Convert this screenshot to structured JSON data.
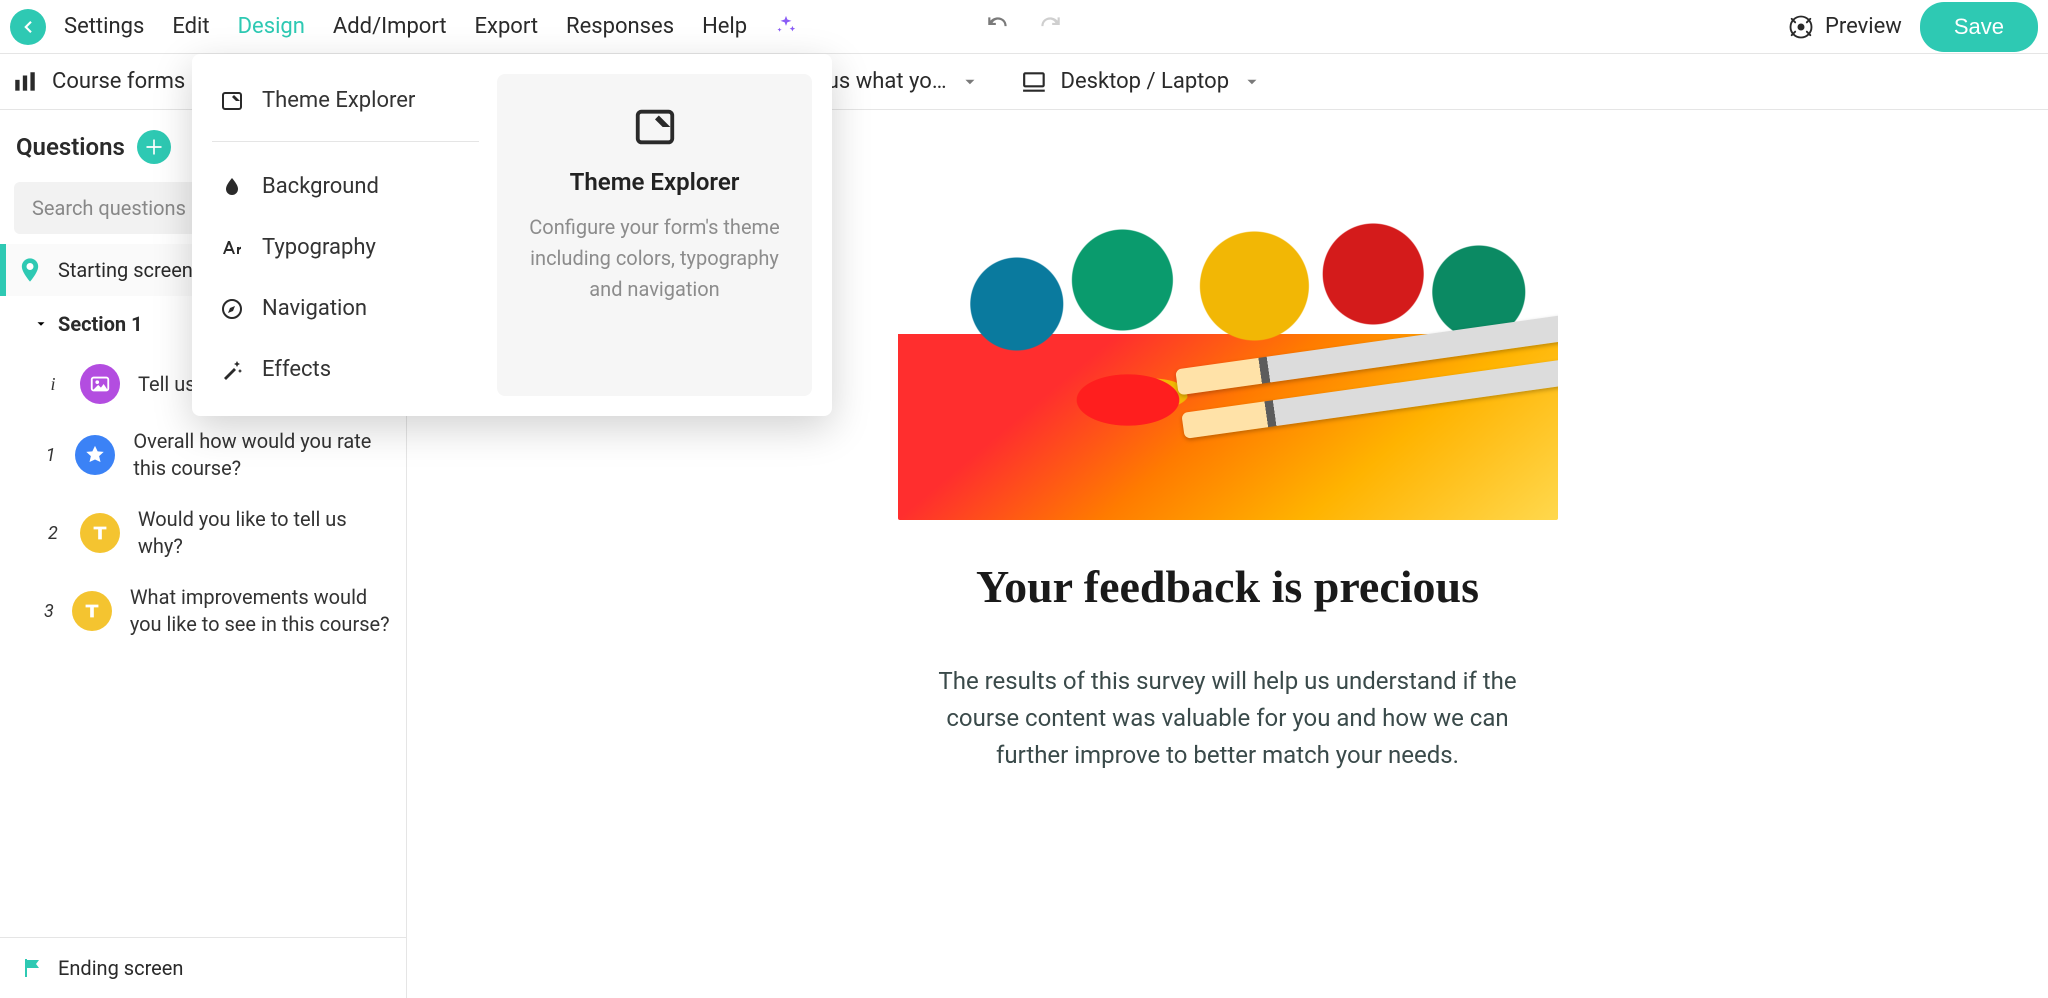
{
  "topbar": {
    "menu": [
      "Settings",
      "Edit",
      "Design",
      "Add/Import",
      "Export",
      "Responses",
      "Help"
    ],
    "active_index": 2,
    "preview_label": "Preview",
    "save_label": "Save"
  },
  "subbar": {
    "breadcrumb": "Course forms",
    "page_selector": "Tell us what yo…",
    "device_selector": "Desktop / Laptop"
  },
  "sidebar": {
    "header": "Questions",
    "search_placeholder": "Search questions",
    "starting_screen": "Starting screen",
    "section_title": "Section 1",
    "questions": [
      {
        "num": "i",
        "text": "Tell us",
        "badge": "purple",
        "icon": "image"
      },
      {
        "num": "1",
        "text": "Overall how would you rate this course?",
        "badge": "blue",
        "icon": "star"
      },
      {
        "num": "2",
        "text": "Would you like to tell us why?",
        "badge": "yellow",
        "icon": "text"
      },
      {
        "num": "3",
        "text": "What  improvements would you like to see in this course?",
        "badge": "yellow",
        "icon": "text"
      }
    ],
    "ending_screen": "Ending screen"
  },
  "dropdown": {
    "items": [
      "Theme Explorer",
      "Background",
      "Typography",
      "Navigation",
      "Effects"
    ],
    "detail_title": "Theme Explorer",
    "detail_desc": "Configure your form's theme including colors, typography and navigation"
  },
  "preview": {
    "title": "Your feedback is precious",
    "description": "The results of this survey will help us understand if the course content was valuable for you and how we can further improve to better match your needs."
  }
}
